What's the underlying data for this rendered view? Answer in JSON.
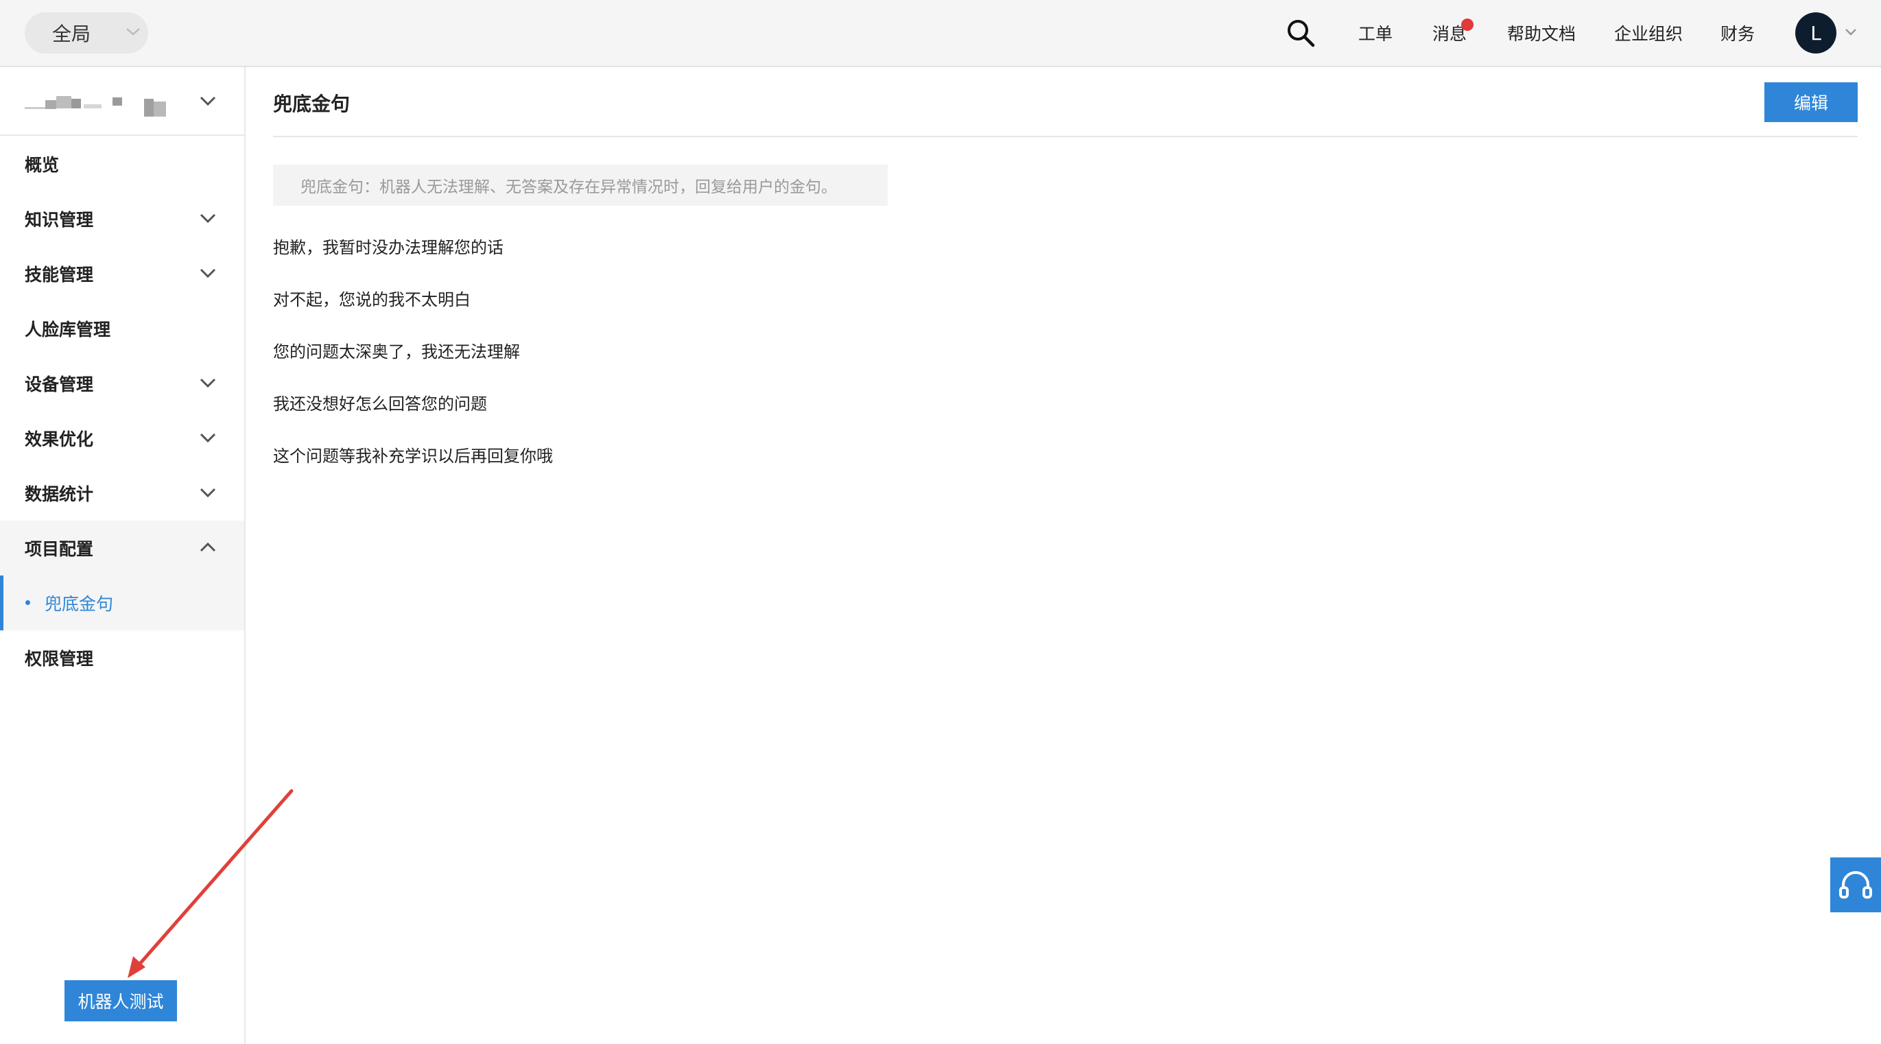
{
  "topbar": {
    "scope_label": "全局",
    "nav": [
      "工单",
      "消息",
      "帮助文档",
      "企业组织",
      "财务"
    ],
    "has_unread_messages": true,
    "avatar_initial": "L"
  },
  "sidebar": {
    "menu": [
      {
        "label": "概览"
      },
      {
        "label": "知识管理"
      },
      {
        "label": "技能管理"
      },
      {
        "label": "人脸库管理"
      },
      {
        "label": "设备管理"
      },
      {
        "label": "效果优化"
      },
      {
        "label": "数据统计"
      },
      {
        "label": "项目配置"
      },
      {
        "label": "权限管理"
      }
    ],
    "active_sub_item": "兜底金句",
    "robot_test_label": "机器人测试"
  },
  "main": {
    "title": "兜底金句",
    "edit_label": "编辑",
    "hint": "兜底金句：机器人无法理解、无答案及存在异常情况时，回复给用户的金句。",
    "sentences": [
      "抱歉，我暂时没办法理解您的话",
      "对不起，您说的我不太明白",
      "您的问题太深奥了，我还无法理解",
      "我还没想好怎么回答您的问题",
      "这个问题等我补充学识以后再回复你哦"
    ]
  },
  "colors": {
    "accent": "#2f86d8",
    "badge": "#e03a3a",
    "annotation_arrow": "#e0403a"
  }
}
